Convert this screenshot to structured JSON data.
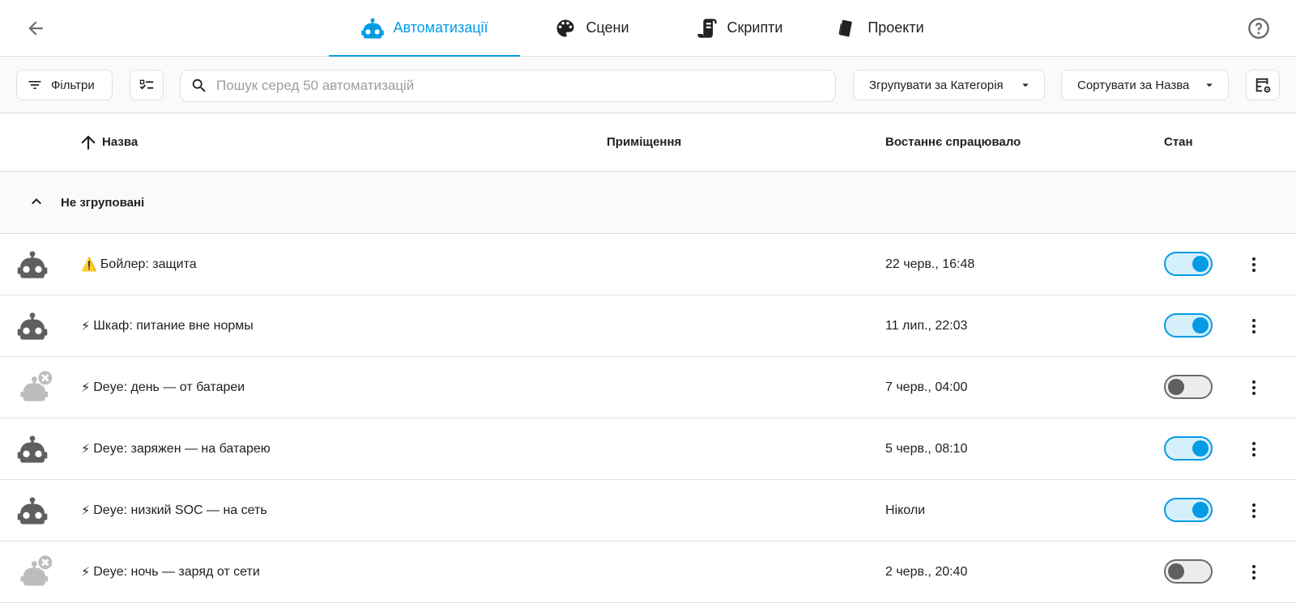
{
  "tabs": [
    {
      "label": "Автоматизації",
      "icon": "robot-icon",
      "active": true
    },
    {
      "label": "Сцени",
      "icon": "palette-icon",
      "active": false
    },
    {
      "label": "Скрипти",
      "icon": "script-icon",
      "active": false
    },
    {
      "label": "Проекти",
      "icon": "blueprint-icon",
      "active": false
    }
  ],
  "toolbar": {
    "filters_label": "Фільтри",
    "search_placeholder": "Пошук серед 50 автоматизацій",
    "group_by_label": "Згрупувати за Категорія",
    "sort_by_label": "Сортувати за Назва"
  },
  "columns": {
    "name": "Назва",
    "area": "Приміщення",
    "last_triggered": "Востаннє спрацювало",
    "state": "Стан"
  },
  "group": {
    "label": "Не згруповані"
  },
  "rows": [
    {
      "emoji": "⚠️",
      "name": "Бойлер: защита",
      "last_triggered": "22 черв., 16:48",
      "enabled": true
    },
    {
      "emoji": "⚡",
      "name": "Шкаф: питание вне нормы",
      "last_triggered": "11 лип., 22:03",
      "enabled": true
    },
    {
      "emoji": "⚡",
      "name": "Deye: день — от батареи",
      "last_triggered": "7 черв., 04:00",
      "enabled": false
    },
    {
      "emoji": "⚡",
      "name": "Deye: заряжен — на батарею",
      "last_triggered": "5 черв., 08:10",
      "enabled": true
    },
    {
      "emoji": "⚡",
      "name": "Deye: низкий SOC — на сеть",
      "last_triggered": "Ніколи",
      "enabled": true
    },
    {
      "emoji": "⚡",
      "name": "Deye: ночь — заряд от сети",
      "last_triggered": "2 черв., 20:40",
      "enabled": false
    }
  ],
  "colors": {
    "accent": "#039be5",
    "icon": "#5f5f5f",
    "disabled_icon": "#bdbdbd"
  }
}
